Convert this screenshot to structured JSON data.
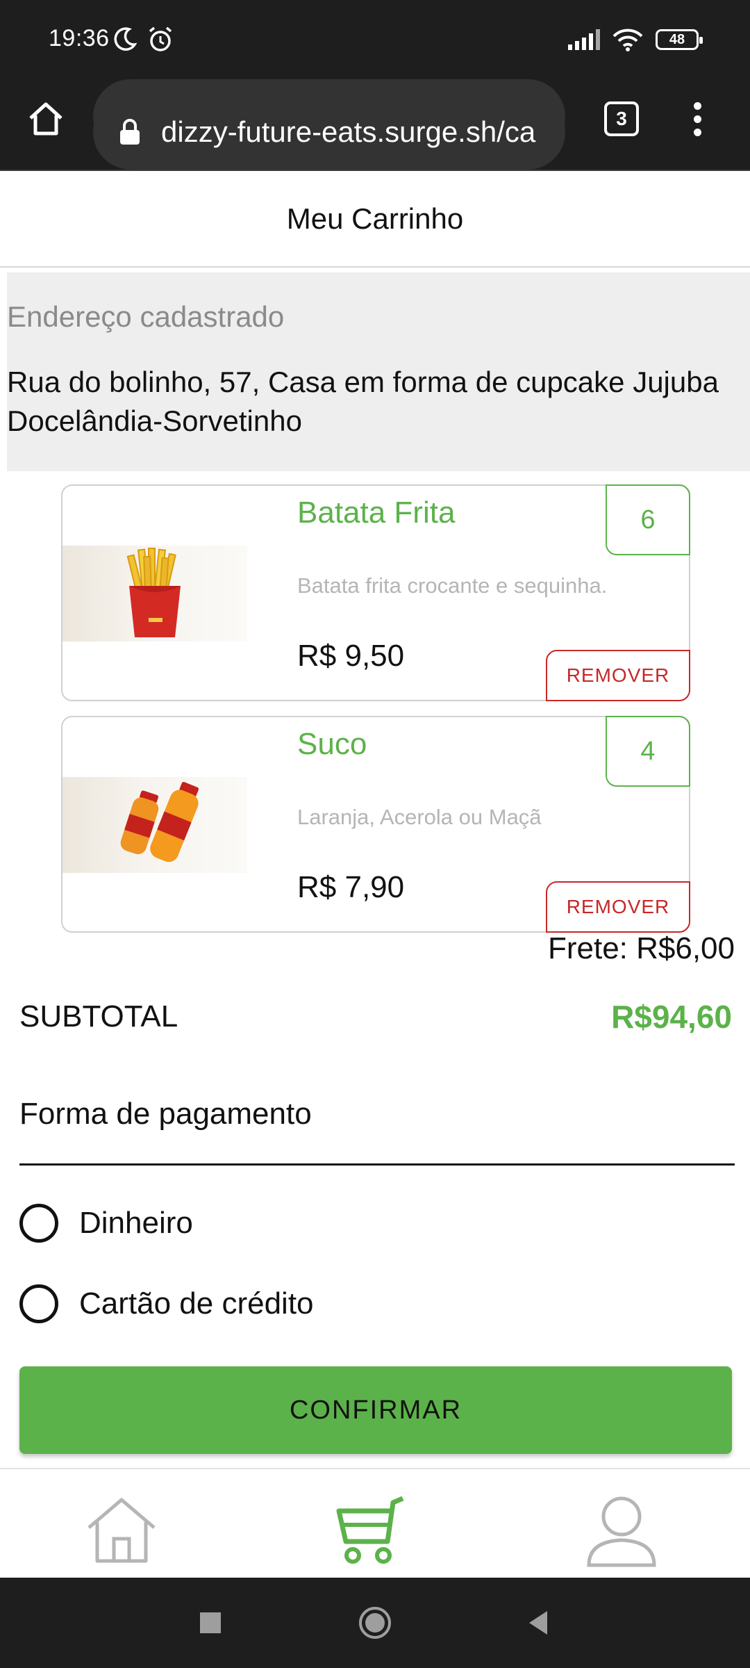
{
  "status_bar": {
    "time": "19:36",
    "battery": "48",
    "icons": [
      "moon-icon",
      "alarm-icon",
      "signal-icon",
      "wifi-icon"
    ]
  },
  "browser": {
    "url": "dizzy-future-eats.surge.sh/ca",
    "tabs_count": "3"
  },
  "header": {
    "title": "Meu Carrinho"
  },
  "address": {
    "label": "Endereço cadastrado",
    "value": "Rua do bolinho, 57, Casa em forma de cupcake Jujuba Docelândia-Sorvetinho"
  },
  "cart": {
    "items": [
      {
        "name": "Batata Frita",
        "description": "Batata frita crocante e sequinha.",
        "price": "R$ 9,50",
        "quantity": "6",
        "remove_label": "REMOVER",
        "image": "fries-image"
      },
      {
        "name": "Suco",
        "description": "Laranja, Acerola ou Maçã",
        "price": "R$ 7,90",
        "quantity": "4",
        "remove_label": "REMOVER",
        "image": "juice-image"
      }
    ]
  },
  "totals": {
    "shipping": "Frete: R$6,00",
    "subtotal_label": "SUBTOTAL",
    "subtotal_value": "R$94,60"
  },
  "payment": {
    "title": "Forma de pagamento",
    "options": [
      "Dinheiro",
      "Cartão de crédito"
    ]
  },
  "confirm_label": "CONFIRMAR",
  "bottom_nav": {
    "items": [
      "home-icon",
      "cart-icon",
      "profile-icon"
    ],
    "active": "cart-icon"
  },
  "colors": {
    "accent": "#5cb24a",
    "danger": "#c62828",
    "bars": "#1e1e1e"
  }
}
